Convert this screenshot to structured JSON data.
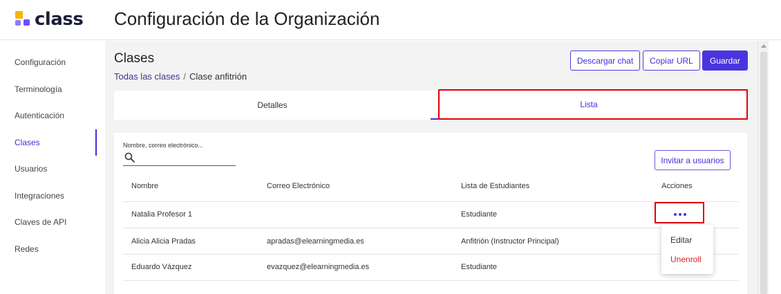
{
  "app": {
    "logo_text": "class",
    "title": "Configuración de la Organización"
  },
  "sidebar": {
    "items": [
      {
        "label": "Configuración",
        "active": false
      },
      {
        "label": "Terminología",
        "active": false
      },
      {
        "label": "Autenticación",
        "active": false
      },
      {
        "label": "Clases",
        "active": true
      },
      {
        "label": "Usuarios",
        "active": false
      },
      {
        "label": "Integraciones",
        "active": false
      },
      {
        "label": "Claves de API",
        "active": false
      },
      {
        "label": "Redes",
        "active": false
      }
    ]
  },
  "header": {
    "section_title": "Clases",
    "breadcrumb": {
      "parent": "Todas las clases",
      "separator": "/",
      "current": "Clase anfitrión"
    },
    "buttons": {
      "download_chat": "Descargar chat",
      "copy_url": "Copiar URL",
      "save": "Guardar"
    }
  },
  "tabs": [
    {
      "label": "Detalles",
      "active": false
    },
    {
      "label": "Lista",
      "active": true
    }
  ],
  "roster": {
    "search": {
      "label": "Nombre, correo electrónico...",
      "value": ""
    },
    "invite_button": "Invitar a usuarios",
    "columns": [
      "Nombre",
      "Correo Electrónico",
      "Lista de Estudiantes",
      "Acciones"
    ],
    "rows": [
      {
        "name": "Natalia Profesor 1",
        "email": "",
        "role": "Estudiante"
      },
      {
        "name": "Alicia Alicia Pradas",
        "email": "apradas@elearningmedia.es",
        "role": "Anfitrión (Instructor Principal)"
      },
      {
        "name": "Eduardo Vázquez",
        "email": "evazquez@elearningmedia.es",
        "role": "Estudiante"
      }
    ],
    "actions_menu": {
      "edit": "Editar",
      "unenroll": "Unenroll"
    }
  },
  "colors": {
    "accent": "#4a34e0",
    "highlight": "#e0000a",
    "danger": "#e02020",
    "logo_yellow": "#f5b400"
  },
  "icons": [
    "search-icon",
    "more-horizontal-icon",
    "logo-icon",
    "scroll-up-arrow-icon"
  ]
}
